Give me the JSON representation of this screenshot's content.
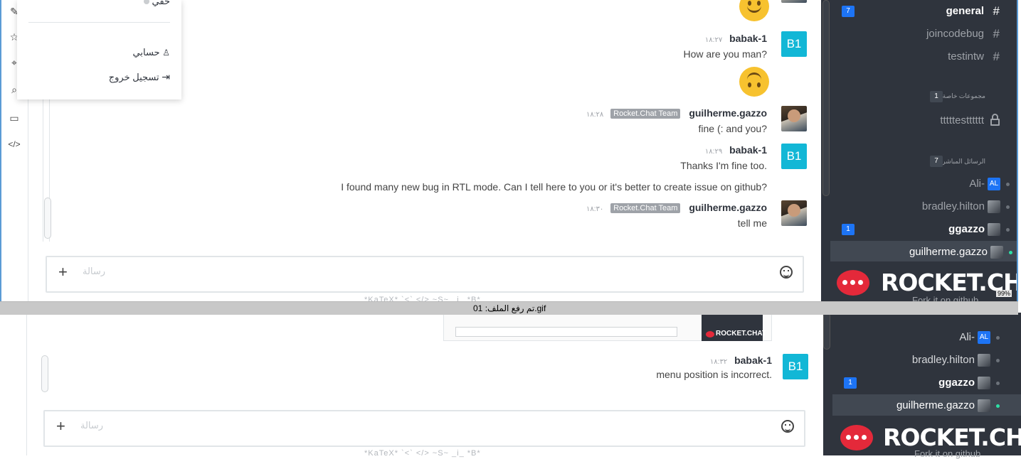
{
  "background": {
    "messages": {
      "upload_thumb_hint": "...",
      "last": {
        "user": "babak-1",
        "time": "١٨:٣٢",
        "text": "menu position is incorrect.",
        "avatar": "B1"
      }
    },
    "composer": {
      "placeholder": "رسالة"
    },
    "hint": "*KaTeX* `<` </> ~S~ _i_ *B*",
    "sidebar": {
      "dm": [
        {
          "name": "Ali-",
          "tag": "AL"
        },
        {
          "name": "bradley.hilton"
        },
        {
          "name": "ggazzo",
          "badge": "1"
        },
        {
          "name": "guilherme.gazzo"
        }
      ],
      "logo": "ROCKET.CHAT",
      "github": "Fork it on github"
    }
  },
  "front": {
    "menu": {
      "top_item": "خفي",
      "account": "حسابي",
      "logout": "تسجيل خروج"
    },
    "messages": [
      {
        "user": "babak-1",
        "time": "١٨:٢٧",
        "text": "How are you man?",
        "avatar": "B1"
      },
      {
        "user": "guilherme.gazzo",
        "time": "١٨:٢٨",
        "tag": "Rocket.Chat Team",
        "text": "fine (: and you?"
      },
      {
        "user": "babak-1",
        "time": "١٨:٢٩",
        "text": "Thanks I'm fine too.",
        "text2": "I found many new bug in RTL mode. Can I tell here to you or it's better to create issue on github?",
        "avatar": "B1"
      },
      {
        "user": "guilherme.gazzo",
        "time": "١٨:٣٠",
        "tag": "Rocket.Chat Team",
        "text": "tell me"
      }
    ],
    "composer": {
      "placeholder": "رسالة"
    },
    "hint": "*KaTeX* `<` </> ~S~ _i_ *B*",
    "sidebar": {
      "channels": [
        {
          "name": "general",
          "badge": "7"
        },
        {
          "name": "joincodebug"
        },
        {
          "name": "testintw"
        }
      ],
      "private_groups": {
        "label": "مجموعات خاصة",
        "count": "1",
        "items": [
          "tttttestttttt"
        ]
      },
      "direct_messages": {
        "label": "الرسائل المباشرة",
        "count": "7"
      },
      "dm": [
        {
          "name": "Ali-",
          "tag": "AL"
        },
        {
          "name": "bradley.hilton"
        },
        {
          "name": "ggazzo",
          "badge": "1"
        },
        {
          "name": "guilherme.gazzo"
        }
      ],
      "logo": "ROCKET.CHAT",
      "github": "Fork it on github"
    }
  },
  "status_bar": {
    "text": "تم رفع الملف: 01.gif",
    "percent": "99%"
  },
  "colors": {
    "accent": "#1d74f5",
    "sidebar": "#2f343d",
    "avatar_b1": "#12b7d6",
    "online": "#2de0a5",
    "logo_red": "#e4293a"
  }
}
